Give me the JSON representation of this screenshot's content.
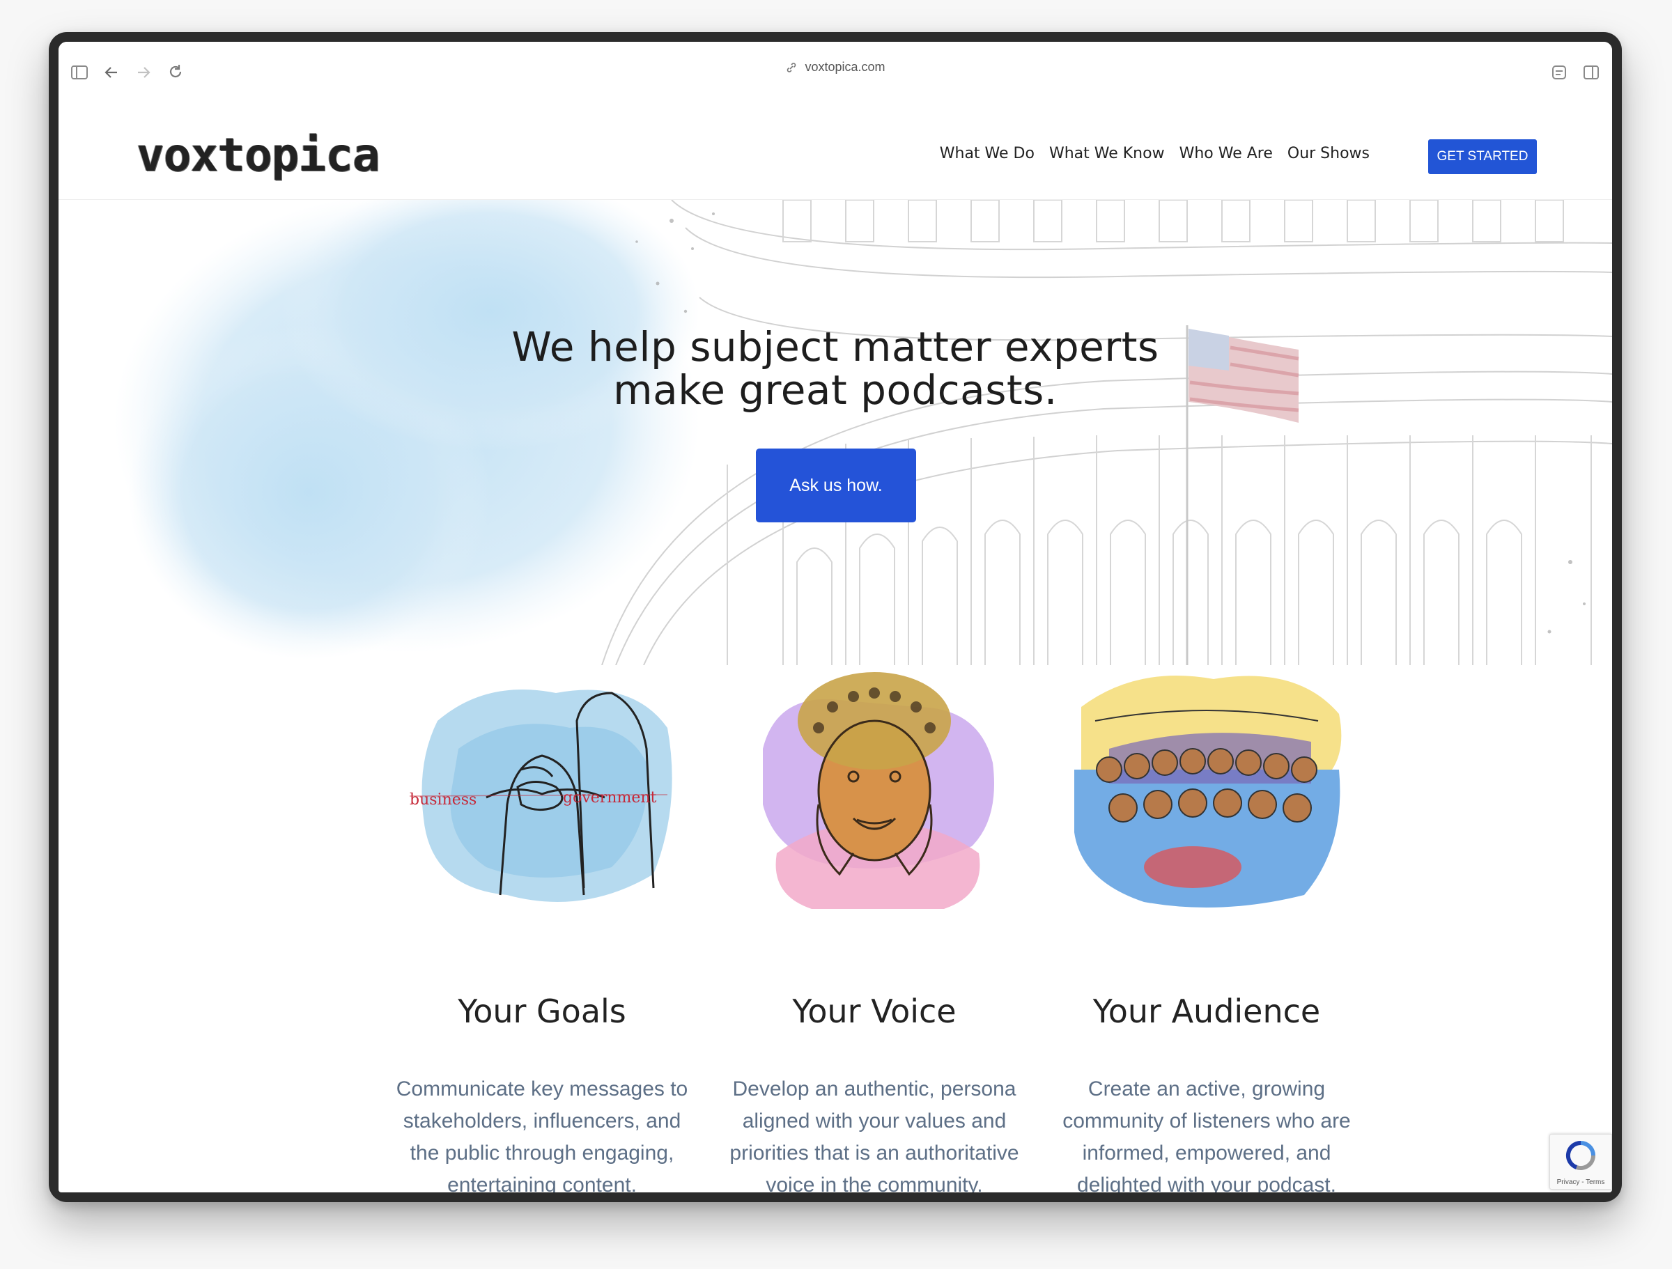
{
  "browser": {
    "url": "voxtopica.com"
  },
  "header": {
    "logo": "voxtopica",
    "nav": [
      "What We Do",
      "What We Know",
      "Who We Are",
      "Our Shows"
    ],
    "cta": "GET STARTED"
  },
  "hero": {
    "title_line1": "We help subject matter experts",
    "title_line2": "make great podcasts.",
    "button": "Ask us how."
  },
  "features": [
    {
      "title": "Your Goals",
      "lines": [
        "Communicate key messages to",
        "stakeholders, influencers, and",
        "the public through engaging,",
        "entertaining content."
      ],
      "art_labels": [
        "business",
        "government"
      ]
    },
    {
      "title": "Your Voice",
      "lines": [
        "Develop an authentic, persona",
        "aligned with your values and",
        "priorities that is an authoritative",
        "voice in the community."
      ]
    },
    {
      "title": "Your Audience",
      "lines": [
        "Create an active, growing",
        "community of listeners who are",
        "informed, empowered, and",
        "delighted with your podcast."
      ]
    }
  ],
  "recaptcha": {
    "text": "Privacy - Terms"
  },
  "colors": {
    "accent": "#2453d8",
    "body_text": "#5d6f86",
    "heading": "#222222",
    "watercolor_blue": "#cfe6f5"
  }
}
